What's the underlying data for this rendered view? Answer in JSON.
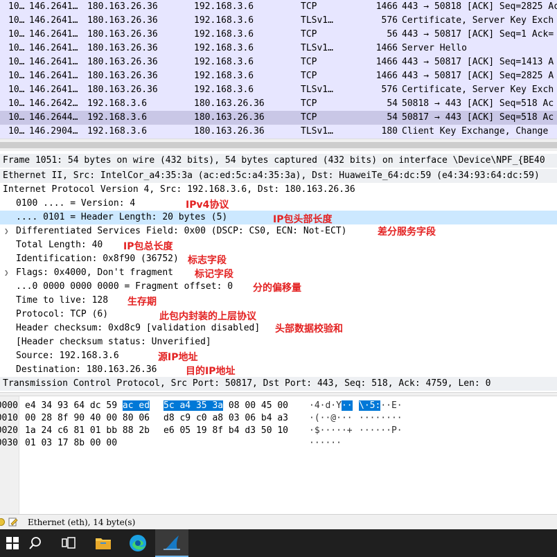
{
  "packet_list": {
    "rows": [
      {
        "no": "10…",
        "time": "146.2641…",
        "src": "180.163.26.36",
        "dst": "192.168.3.6",
        "proto": "TCP",
        "len": "1466",
        "info": "443 → 50818 [ACK] Seq=2825 Ack",
        "selected": false
      },
      {
        "no": "10…",
        "time": "146.2641…",
        "src": "180.163.26.36",
        "dst": "192.168.3.6",
        "proto": "TLSv1…",
        "len": "576",
        "info": "Certificate, Server Key Exch",
        "selected": false
      },
      {
        "no": "10…",
        "time": "146.2641…",
        "src": "180.163.26.36",
        "dst": "192.168.3.6",
        "proto": "TCP",
        "len": "56",
        "info": "443 → 50817 [ACK] Seq=1 Ack=",
        "selected": false
      },
      {
        "no": "10…",
        "time": "146.2641…",
        "src": "180.163.26.36",
        "dst": "192.168.3.6",
        "proto": "TLSv1…",
        "len": "1466",
        "info": "Server Hello",
        "selected": false
      },
      {
        "no": "10…",
        "time": "146.2641…",
        "src": "180.163.26.36",
        "dst": "192.168.3.6",
        "proto": "TCP",
        "len": "1466",
        "info": "443 → 50817 [ACK] Seq=1413 A",
        "selected": false
      },
      {
        "no": "10…",
        "time": "146.2641…",
        "src": "180.163.26.36",
        "dst": "192.168.3.6",
        "proto": "TCP",
        "len": "1466",
        "info": "443 → 50817 [ACK] Seq=2825 A",
        "selected": false
      },
      {
        "no": "10…",
        "time": "146.2641…",
        "src": "180.163.26.36",
        "dst": "192.168.3.6",
        "proto": "TLSv1…",
        "len": "576",
        "info": "Certificate, Server Key Exch",
        "selected": false
      },
      {
        "no": "10…",
        "time": "146.2642…",
        "src": "192.168.3.6",
        "dst": "180.163.26.36",
        "proto": "TCP",
        "len": "54",
        "info": "50818 → 443 [ACK] Seq=518 Ac",
        "selected": false
      },
      {
        "no": "10…",
        "time": "146.2644…",
        "src": "192.168.3.6",
        "dst": "180.163.26.36",
        "proto": "TCP",
        "len": "54",
        "info": "50817 → 443 [ACK] Seq=518 Ac",
        "selected": true
      },
      {
        "no": "10…",
        "time": "146.2904…",
        "src": "192.168.3.6",
        "dst": "180.163.26.36",
        "proto": "TLSv1…",
        "len": "180",
        "info": "Client Key Exchange, Change",
        "selected": false
      }
    ]
  },
  "details": {
    "frame": "Frame 1051: 54 bytes on wire (432 bits), 54 bytes captured (432 bits) on interface \\Device\\NPF_{BE40",
    "ethernet": "Ethernet II, Src: IntelCor_a4:35:3a (ac:ed:5c:a4:35:3a), Dst: HuaweiTe_64:dc:59 (e4:34:93:64:dc:59)",
    "ip": "Internet Protocol Version 4, Src: 192.168.3.6, Dst: 180.163.26.36",
    "version": "0100 .... = Version: 4",
    "header_length": ".... 0101 = Header Length: 20 bytes (5)",
    "dsfield": "Differentiated Services Field: 0x00 (DSCP: CS0, ECN: Not-ECT)",
    "total_length": "Total Length: 40",
    "identification": "Identification: 0x8f90 (36752)",
    "flags": "Flags: 0x4000, Don't fragment",
    "frag_offset": "...0 0000 0000 0000 = Fragment offset: 0",
    "ttl": "Time to live: 128",
    "protocol": "Protocol: TCP (6)",
    "checksum": "Header checksum: 0xd8c9 [validation disabled]",
    "checksum_status": "[Header checksum status: Unverified]",
    "source": "Source: 192.168.3.6",
    "destination": "Destination: 180.163.26.36",
    "tcp": "Transmission Control Protocol, Src Port: 50817, Dst Port: 443, Seq: 518, Ack: 4759, Len: 0"
  },
  "annotations": {
    "version": "IPv4协议",
    "header_length": "IP包头部长度",
    "dsfield": "差分服务字段",
    "total_length": "IP包总长度",
    "identification": "标志字段",
    "flags": "标记字段",
    "frag_offset": "分的偏移量",
    "ttl": "生存期",
    "protocol": "此包内封装的上层协议",
    "checksum": "头部数据校验和",
    "source": "源IP地址",
    "destination": "目的IP地址"
  },
  "bytes": {
    "rows": [
      {
        "offset": "0000",
        "hex1_pre": "e4 34 93 64 dc 59 ",
        "hex1_hl": "ac ed",
        "hex2_hl": "5c a4 35 3a",
        "hex2_post": " 08 00 45 00",
        "asc1_pre": "·4·d·Y",
        "asc1_hl": "··",
        "asc2_hl": "\\·5:",
        "asc2_post": "··E·"
      },
      {
        "offset": "0010",
        "hex1_pre": "00 28 8f 90 40 00 80 06",
        "hex1_hl": "",
        "hex2_hl": "",
        "hex2_post": "d8 c9 c0 a8 03 06 b4 a3",
        "asc1_pre": "·(··@···",
        "asc1_hl": "",
        "asc2_hl": "",
        "asc2_post": "········"
      },
      {
        "offset": "0020",
        "hex1_pre": "1a 24 c6 81 01 bb 88 2b",
        "hex1_hl": "",
        "hex2_hl": "",
        "hex2_post": "e6 05 19 8f b4 d3 50 10",
        "asc1_pre": "·$·····+",
        "asc1_hl": "",
        "asc2_hl": "",
        "asc2_post": "······P·"
      },
      {
        "offset": "0030",
        "hex1_pre": "01 03 17 8b 00 00",
        "hex1_hl": "",
        "hex2_hl": "",
        "hex2_post": "",
        "asc1_pre": "······",
        "asc1_hl": "",
        "asc2_hl": "",
        "asc2_post": ""
      }
    ]
  },
  "status": {
    "text": "Ethernet (eth), 14 byte(s)"
  },
  "taskbar": {
    "items": [
      "windows-start-icon",
      "search-icon",
      "task-view-icon",
      "file-explorer-icon",
      "edge-browser-icon",
      "wireshark-icon"
    ]
  }
}
